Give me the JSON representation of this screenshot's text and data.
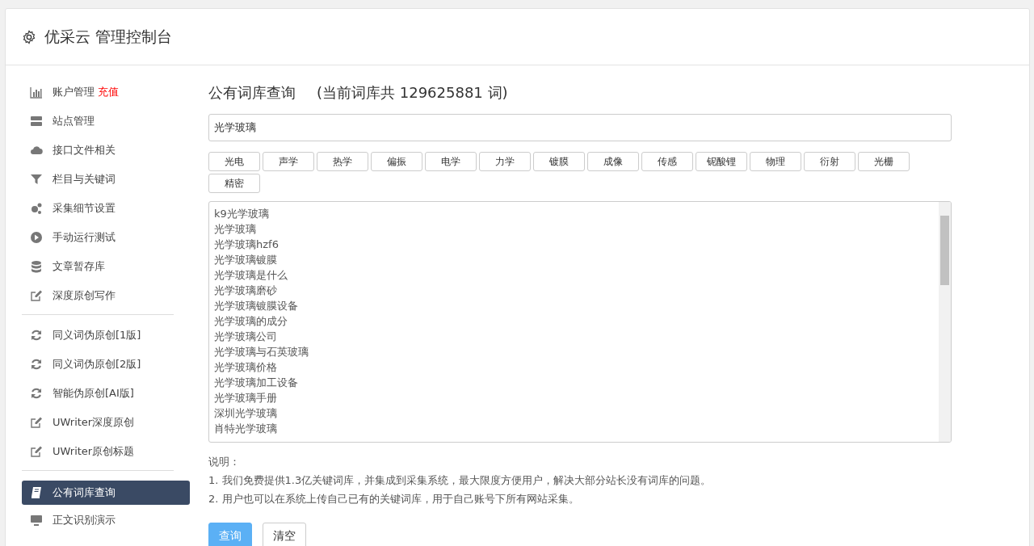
{
  "header": {
    "title": "优采云 管理控制台"
  },
  "sidebar": {
    "groups": [
      [
        {
          "label": "账户管理",
          "badge": "充值",
          "selected": false
        },
        {
          "label": "站点管理",
          "selected": false
        },
        {
          "label": "接口文件相关",
          "selected": false
        },
        {
          "label": "栏目与关键词",
          "selected": false
        },
        {
          "label": "采集细节设置",
          "selected": false
        },
        {
          "label": "手动运行测试",
          "selected": false
        },
        {
          "label": "文章暂存库",
          "selected": false
        },
        {
          "label": "深度原创写作",
          "selected": false
        }
      ],
      [
        {
          "label": "同义词伪原创[1版]",
          "selected": false
        },
        {
          "label": "同义词伪原创[2版]",
          "selected": false
        },
        {
          "label": "智能伪原创[AI版]",
          "selected": false
        },
        {
          "label": "UWriter深度原创",
          "selected": false
        },
        {
          "label": "UWriter原创标题",
          "selected": false
        }
      ],
      [
        {
          "label": "公有词库查询",
          "selected": true
        },
        {
          "label": "正文识别演示",
          "selected": false
        }
      ]
    ]
  },
  "main": {
    "title": "公有词库查询",
    "count": "(当前词库共 129625881 词)",
    "search": {
      "value": "光学玻璃"
    },
    "tags": [
      "光电",
      "声学",
      "热学",
      "偏振",
      "电学",
      "力学",
      "镀膜",
      "成像",
      "传感",
      "铌酸锂",
      "物理",
      "衍射",
      "光栅",
      "精密"
    ],
    "results": [
      "k9光学玻璃",
      "光学玻璃",
      "光学玻璃hzf6",
      "光学玻璃镀膜",
      "光学玻璃是什么",
      "光学玻璃磨砂",
      "光学玻璃镀膜设备",
      "光学玻璃的成分",
      "光学玻璃公司",
      "光学玻璃与石英玻璃",
      "光学玻璃价格",
      "光学玻璃加工设备",
      "光学玻璃手册",
      "深圳光学玻璃",
      "肖特光学玻璃"
    ],
    "notes_title": "说明：",
    "notes": [
      "1. 我们免费提供1.3亿关键词库，并集成到采集系统，最大限度方便用户，解决大部分站长没有词库的问题。",
      "2. 用户也可以在系统上传自己已有的关键词库，用于自己账号下所有网站采集。"
    ],
    "buttons": [
      {
        "label": "查询",
        "kind": "primary"
      },
      {
        "label": "清空",
        "kind": "default"
      }
    ]
  }
}
